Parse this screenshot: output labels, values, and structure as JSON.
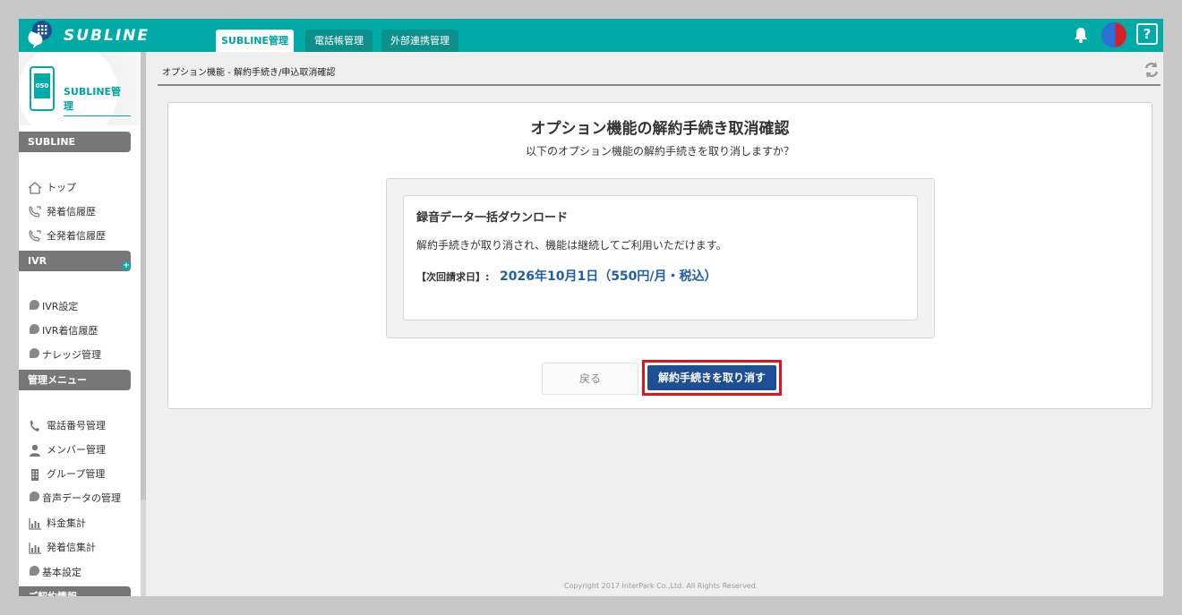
{
  "header": {
    "logo_text": "SUBLINE",
    "tabs": [
      {
        "label": "SUBLINE管理"
      },
      {
        "label": "電話帳管理"
      },
      {
        "label": "外部連携管理"
      }
    ],
    "help_label": "?"
  },
  "sidebar": {
    "brand_label": "SUBLINE管理",
    "phone_number_label": "050",
    "sections": [
      {
        "title": "SUBLINE",
        "items": [
          {
            "label": "トップ"
          },
          {
            "label": "発着信履歴"
          },
          {
            "label": "全発着信履歴"
          }
        ]
      },
      {
        "title": "IVR",
        "items": [
          {
            "label": "IVR設定"
          },
          {
            "label": "IVR着信履歴"
          },
          {
            "label": "ナレッジ管理"
          }
        ]
      },
      {
        "title": "管理メニュー",
        "items": [
          {
            "label": "電話番号管理"
          },
          {
            "label": "メンバー管理"
          },
          {
            "label": "グループ管理"
          },
          {
            "label": "音声データの管理"
          },
          {
            "label": "料金集計"
          },
          {
            "label": "発着信集計"
          },
          {
            "label": "基本設定"
          }
        ]
      },
      {
        "title": "ご契約情報"
      }
    ]
  },
  "breadcrumb": "オプション機能 - 解約手続き/申込取消確認",
  "panel": {
    "title": "オプション機能の解約手続き取消確認",
    "subtitle": "以下のオプション機能の解約手続きを取り消しますか？",
    "option": {
      "name": "録音データ一括ダウンロード",
      "message": "解約手続きが取り消され、機能は継続してご利用いただけます。",
      "billing_label": "【次回請求日】:",
      "billing_value": "2026年10月1日（550円/月・税込）"
    },
    "back_label": "戻る",
    "confirm_label": "解約手続きを取り消す"
  },
  "footer": {
    "copyright": "Copyright 2017 InterPark Co.,Ltd. All Rights Reserved."
  },
  "colors": {
    "brand": "#00aaa6",
    "primary_button": "#1e4f94",
    "highlight": "#e0141c",
    "billing_value": "#1f5ea8"
  }
}
